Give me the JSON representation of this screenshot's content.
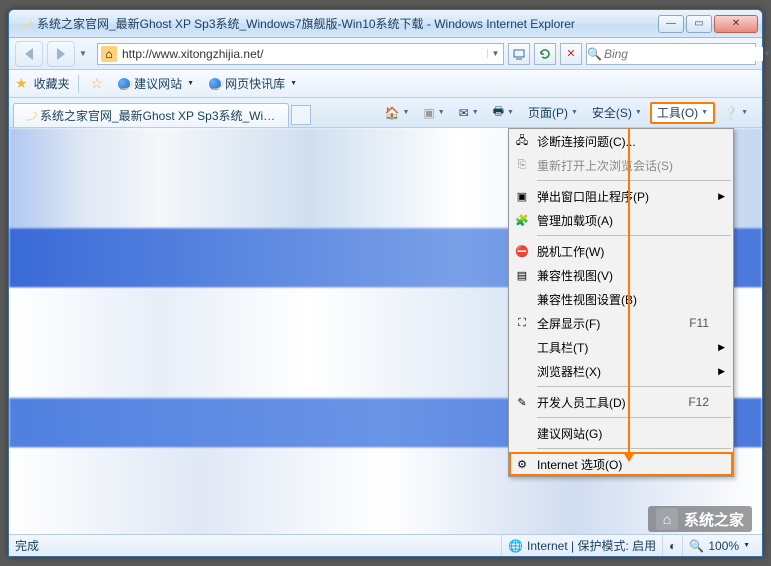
{
  "window": {
    "title": "系统之家官网_最新Ghost XP Sp3系统_Windows7旗舰版-Win10系统下载 - Windows Internet Explorer"
  },
  "address": {
    "url": "http://www.xitongzhijia.net/"
  },
  "search": {
    "placeholder": "Bing"
  },
  "favbar": {
    "label": "收藏夹",
    "item1": "建议网站",
    "item2": "网页快讯库"
  },
  "tab": {
    "title": "系统之家官网_最新Ghost XP Sp3系统_Window..."
  },
  "cmdbar": {
    "page": "页面(P)",
    "safety": "安全(S)",
    "tools": "工具(O)"
  },
  "menu": {
    "diag": "诊断连接问题(C)...",
    "reopen": "重新打开上次浏览会话(S)",
    "popup": "弹出窗口阻止程序(P)",
    "addons": "管理加载项(A)",
    "offline": "脱机工作(W)",
    "compat": "兼容性视图(V)",
    "compat_s": "兼容性视图设置(B)",
    "fullscreen": "全屏显示(F)",
    "fullscreen_sc": "F11",
    "toolbars": "工具栏(T)",
    "explorer": "浏览器栏(X)",
    "dev": "开发人员工具(D)",
    "dev_sc": "F12",
    "suggest": "建议网站(G)",
    "options": "Internet 选项(O)"
  },
  "status": {
    "done": "完成",
    "zone": "Internet | 保护模式: 启用",
    "zoom": "100%"
  },
  "watermark": "系统之家"
}
